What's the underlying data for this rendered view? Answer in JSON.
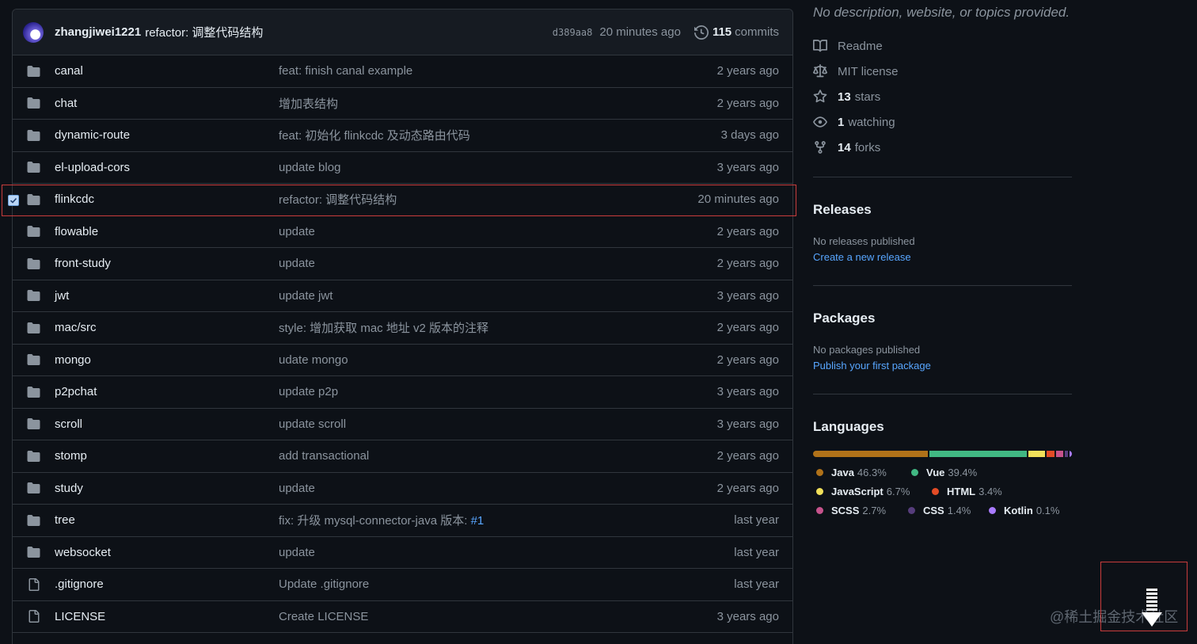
{
  "latest_commit": {
    "author": "zhangjiwei1221",
    "message": "refactor: 调整代码结构",
    "sha": "d389aa8",
    "time": "20 minutes ago",
    "commits_count": "115",
    "commits_label": "commits"
  },
  "files": [
    {
      "type": "folder",
      "name": "canal",
      "message": "feat: finish canal example",
      "time": "2 years ago"
    },
    {
      "type": "folder",
      "name": "chat",
      "message": "增加表结构",
      "time": "2 years ago"
    },
    {
      "type": "folder",
      "name": "dynamic-route",
      "message": "feat: 初始化 flinkcdc 及动态路由代码",
      "time": "3 days ago"
    },
    {
      "type": "folder",
      "name": "el-upload-cors",
      "message": "update blog",
      "time": "3 years ago"
    },
    {
      "type": "folder",
      "name": "flinkcdc",
      "message": "refactor: 调整代码结构",
      "time": "20 minutes ago",
      "selected": true
    },
    {
      "type": "folder",
      "name": "flowable",
      "message": "update",
      "time": "2 years ago"
    },
    {
      "type": "folder",
      "name": "front-study",
      "message": "update",
      "time": "2 years ago"
    },
    {
      "type": "folder",
      "name": "jwt",
      "message": "update jwt",
      "time": "3 years ago"
    },
    {
      "type": "folder",
      "name": "mac/src",
      "message": "style: 增加获取 mac 地址 v2 版本的注释",
      "time": "2 years ago"
    },
    {
      "type": "folder",
      "name": "mongo",
      "message": "udate mongo",
      "time": "2 years ago"
    },
    {
      "type": "folder",
      "name": "p2pchat",
      "message": "update p2p",
      "time": "3 years ago"
    },
    {
      "type": "folder",
      "name": "scroll",
      "message": "update scroll",
      "time": "3 years ago"
    },
    {
      "type": "folder",
      "name": "stomp",
      "message": "add transactional",
      "time": "2 years ago"
    },
    {
      "type": "folder",
      "name": "study",
      "message": "update",
      "time": "2 years ago"
    },
    {
      "type": "folder",
      "name": "tree",
      "message": "fix: 升级 mysql-connector-java 版本: ",
      "link": "#1",
      "time": "last year"
    },
    {
      "type": "folder",
      "name": "websocket",
      "message": "update",
      "time": "last year"
    },
    {
      "type": "file",
      "name": ".gitignore",
      "message": "Update .gitignore",
      "time": "last year"
    },
    {
      "type": "file",
      "name": "LICENSE",
      "message": "Create LICENSE",
      "time": "3 years ago"
    }
  ],
  "about": {
    "description": "No description, website, or topics provided.",
    "readme": "Readme",
    "license": "MIT license",
    "stars_count": "13",
    "stars_label": "stars",
    "watching_count": "1",
    "watching_label": "watching",
    "forks_count": "14",
    "forks_label": "forks"
  },
  "releases": {
    "title": "Releases",
    "empty_text": "No releases published",
    "link": "Create a new release"
  },
  "packages": {
    "title": "Packages",
    "empty_text": "No packages published",
    "link": "Publish your first package"
  },
  "languages": {
    "title": "Languages",
    "items": [
      {
        "name": "Java",
        "percent": "46.3%",
        "value": 46.3,
        "color": "#b07219"
      },
      {
        "name": "Vue",
        "percent": "39.4%",
        "value": 39.4,
        "color": "#41b883"
      },
      {
        "name": "JavaScript",
        "percent": "6.7%",
        "value": 6.7,
        "color": "#f1e05a"
      },
      {
        "name": "HTML",
        "percent": "3.4%",
        "value": 3.4,
        "color": "#e34c26"
      },
      {
        "name": "SCSS",
        "percent": "2.7%",
        "value": 2.7,
        "color": "#c6538c"
      },
      {
        "name": "CSS",
        "percent": "1.4%",
        "value": 1.4,
        "color": "#563d7c"
      },
      {
        "name": "Kotlin",
        "percent": "0.1%",
        "value": 0.1,
        "color": "#a97bff"
      }
    ]
  },
  "watermark": "@稀土掘金技术社区"
}
